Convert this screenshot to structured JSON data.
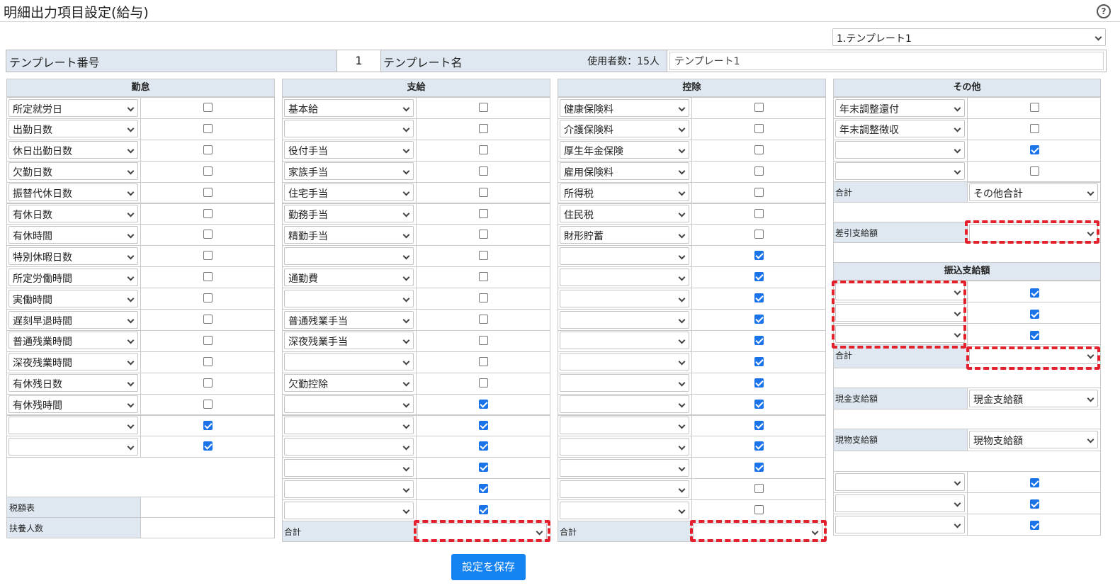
{
  "header": {
    "title": "明細出力項目設定(給与)",
    "help": "?"
  },
  "template_select": "1.テンプレート1",
  "info": {
    "number_label": "テンプレート番号",
    "number_value": "1",
    "name_label": "テンプレート名",
    "users": "使用者数：15人",
    "name_value": "テンプレート1"
  },
  "columns": [
    {
      "title": "勤怠",
      "rows": [
        {
          "label": "所定就労日",
          "checked": false
        },
        {
          "label": "出勤日数",
          "checked": false
        },
        {
          "label": "休日出勤日数",
          "checked": false
        },
        {
          "label": "欠勤日数",
          "checked": false
        },
        {
          "label": "振替代休日数",
          "checked": false
        },
        {
          "label": "有休日数",
          "checked": false
        },
        {
          "label": "有休時間",
          "checked": false
        },
        {
          "label": "特別休暇日数",
          "checked": false
        },
        {
          "label": "所定労働時間",
          "checked": false
        },
        {
          "label": "実働時間",
          "checked": false
        },
        {
          "label": "遅刻早退時間",
          "checked": false
        },
        {
          "label": "普通残業時間",
          "checked": false
        },
        {
          "label": "深夜残業時間",
          "checked": false
        },
        {
          "label": "有休残日数",
          "checked": false
        },
        {
          "label": "有休残時間",
          "checked": false
        },
        {
          "label": "",
          "checked": true
        },
        {
          "label": "",
          "checked": true
        }
      ],
      "footer": [
        "税額表",
        "扶養人数"
      ]
    },
    {
      "title": "支給",
      "rows": [
        {
          "label": "基本給",
          "checked": false
        },
        {
          "label": "",
          "checked": false
        },
        {
          "label": "役付手当",
          "checked": false
        },
        {
          "label": "家族手当",
          "checked": false
        },
        {
          "label": "住宅手当",
          "checked": false
        },
        {
          "label": "勤務手当",
          "checked": false
        },
        {
          "label": "精勤手当",
          "checked": false
        },
        {
          "label": "",
          "checked": false
        },
        {
          "label": "通勤費",
          "checked": false
        },
        {
          "label": "",
          "checked": false
        },
        {
          "label": "普通残業手当",
          "checked": false
        },
        {
          "label": "深夜残業手当",
          "checked": false
        },
        {
          "label": "",
          "checked": false
        },
        {
          "label": "欠勤控除",
          "checked": false
        },
        {
          "label": "",
          "checked": true
        },
        {
          "label": "",
          "checked": true
        },
        {
          "label": "",
          "checked": true
        },
        {
          "label": "",
          "checked": true
        },
        {
          "label": "",
          "checked": true
        },
        {
          "label": "",
          "checked": true
        }
      ],
      "total_label": "合計"
    },
    {
      "title": "控除",
      "rows": [
        {
          "label": "健康保険料",
          "checked": false
        },
        {
          "label": "介護保険料",
          "checked": false
        },
        {
          "label": "厚生年金保険",
          "checked": false
        },
        {
          "label": "雇用保険料",
          "checked": false
        },
        {
          "label": "所得税",
          "checked": false
        },
        {
          "label": "住民税",
          "checked": false
        },
        {
          "label": "財形貯蓄",
          "checked": false
        },
        {
          "label": "",
          "checked": true
        },
        {
          "label": "",
          "checked": true
        },
        {
          "label": "",
          "checked": true
        },
        {
          "label": "",
          "checked": true
        },
        {
          "label": "",
          "checked": true
        },
        {
          "label": "",
          "checked": true
        },
        {
          "label": "",
          "checked": true
        },
        {
          "label": "",
          "checked": true
        },
        {
          "label": "",
          "checked": true
        },
        {
          "label": "",
          "checked": true
        },
        {
          "label": "",
          "checked": true
        },
        {
          "label": "",
          "checked": false
        },
        {
          "label": "",
          "checked": false
        }
      ],
      "total_label": "合計"
    }
  ],
  "other": {
    "title": "その他",
    "rows": [
      {
        "label": "年末調整還付",
        "checked": false
      },
      {
        "label": "年末調整徴収",
        "checked": false
      },
      {
        "label": "",
        "checked": true
      },
      {
        "label": "",
        "checked": false
      }
    ],
    "total_label": "合計",
    "total_value": "その他合計",
    "net_label": "差引支給額",
    "transfer_title": "振込支給額",
    "transfer_rows": [
      {
        "checked": true
      },
      {
        "checked": true
      },
      {
        "checked": true
      }
    ],
    "transfer_total_label": "合計",
    "cash_label": "現金支給額",
    "cash_value": "現金支給額",
    "kind_label": "現物支給額",
    "kind_value": "現物支給額",
    "extra_rows": [
      {
        "checked": true
      },
      {
        "checked": true
      },
      {
        "checked": true
      }
    ]
  },
  "save_label": "設定を保存"
}
